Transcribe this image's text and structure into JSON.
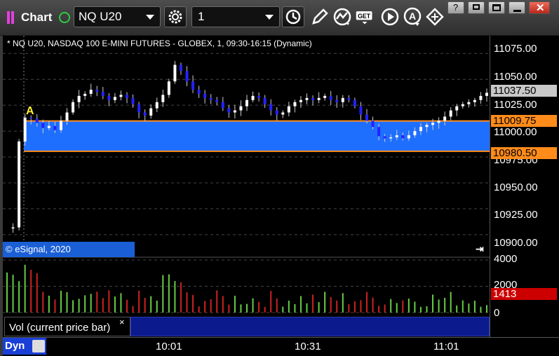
{
  "toolbar": {
    "chart_label": "Chart",
    "symbol": "NQ U20",
    "interval": "1"
  },
  "chart": {
    "title": "* NQ U20, NASDAQ 100 E-MINI FUTURES - GLOBEX, 1, 09:30-16:15 (Dynamic)",
    "copyright": "© eSignal, 2020",
    "marker_label": "A",
    "study_label": "Vol (current price bar)",
    "study_close": "×",
    "dyn_label": "Dyn",
    "price_ticks": [
      "11075.00",
      "11050.00",
      "11025.00",
      "11000.00",
      "10975.00",
      "10950.00",
      "10925.00",
      "10900.00"
    ],
    "current_price": "11037.50",
    "zone_high": "11009.75",
    "zone_low": "10980.50",
    "vol_ticks": [
      "4000",
      "2000",
      "0"
    ],
    "current_vol": "1413",
    "time_ticks": [
      "10:01",
      "10:31",
      "11:01"
    ]
  },
  "chart_data": {
    "type": "candlestick",
    "ylim": [
      10885,
      11085
    ],
    "zone": [
      10980.5,
      11009.75
    ],
    "last_price": 11037.5,
    "volume_ylim": [
      0,
      4000
    ],
    "last_volume": 1413
  },
  "colors": {
    "up": "#ffffff",
    "down": "#2222ff",
    "zone_fill": "#1f6fff",
    "zone_line": "#ff8c1a",
    "vol_up": "#66cc44",
    "vol_down": "#cc2222",
    "study_bg": "#0b1a8c"
  }
}
